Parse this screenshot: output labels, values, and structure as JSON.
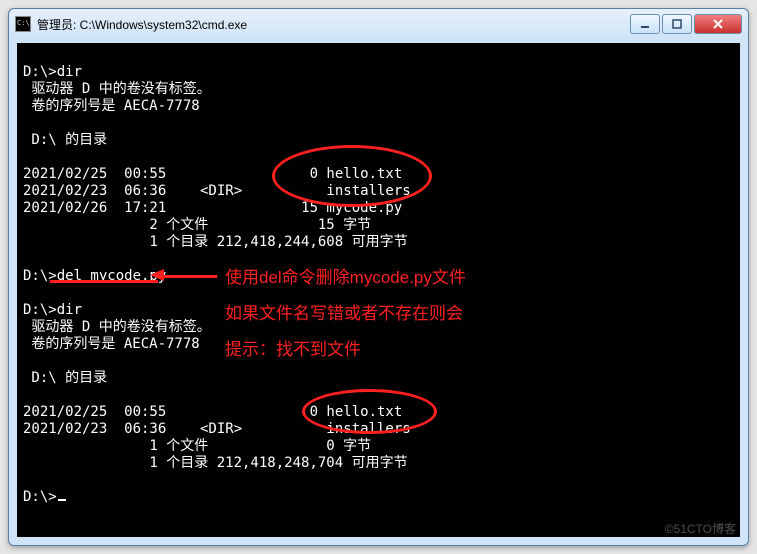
{
  "window": {
    "title": "管理员: C:\\Windows\\system32\\cmd.exe"
  },
  "terminal": {
    "lines": [
      "",
      "D:\\>dir",
      " 驱动器 D 中的卷没有标签。",
      " 卷的序列号是 AECA-7778",
      "",
      " D:\\ 的目录",
      "",
      "2021/02/25  00:55                 0 hello.txt",
      "2021/02/23  06:36    <DIR>          installers",
      "2021/02/26  17:21                15 mycode.py",
      "               2 个文件             15 字节",
      "               1 个目录 212,418,244,608 可用字节",
      "",
      "D:\\>del mycode.py",
      "",
      "D:\\>dir",
      " 驱动器 D 中的卷没有标签。",
      " 卷的序列号是 AECA-7778",
      "",
      " D:\\ 的目录",
      "",
      "2021/02/25  00:55                 0 hello.txt",
      "2021/02/23  06:36    <DIR>          installers",
      "               1 个文件              0 字节",
      "               1 个目录 212,418,248,704 可用字节",
      "",
      "D:\\>"
    ]
  },
  "annotations": {
    "line1": "使用del命令删除mycode.py文件",
    "line2": "如果文件名写错或者不存在则会",
    "line3": "提示：找不到文件"
  },
  "watermark": "©51CTO博客"
}
